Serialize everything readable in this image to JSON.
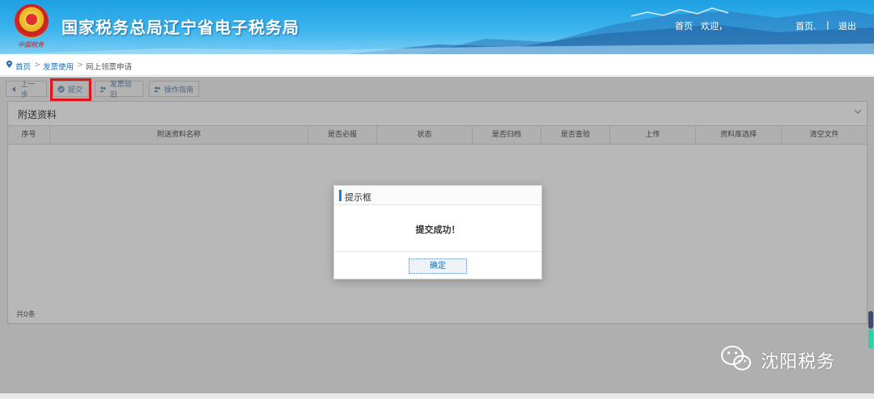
{
  "header": {
    "site_title": "国家税务总局辽宁省电子税务局",
    "emblem_caption": "中国税务",
    "home_link": "首页",
    "welcome_text": "欢迎，",
    "home_link_right": "首页.",
    "separator": "|",
    "logout_link": "退出"
  },
  "breadcrumb": {
    "items": [
      "首页",
      "发票使用",
      "网上领票申请"
    ],
    "separator": ">"
  },
  "toolbar": {
    "prev_label": "上一步",
    "submit_label": "提交",
    "invoice_verify_label": "发票验旧",
    "operation_guide_label": "操作指南"
  },
  "panel": {
    "title": "附送资料",
    "columns": [
      "序号",
      "附送资料名称",
      "是否必报",
      "状态",
      "是否归档",
      "是否查验",
      "上传",
      "资料库选择",
      "清空文件"
    ],
    "total_text": "共0条"
  },
  "dialog": {
    "title": "提示框",
    "message": "提交成功！",
    "ok_label": "确定"
  },
  "watermark": {
    "text": "沈阳税务",
    "icon": "wechat-icon"
  },
  "colors": {
    "header_blue": "#1ea0e2",
    "link_blue": "#1a6fb8",
    "highlight_red": "#e0161b",
    "dialog_accent": "#1f7fce"
  }
}
